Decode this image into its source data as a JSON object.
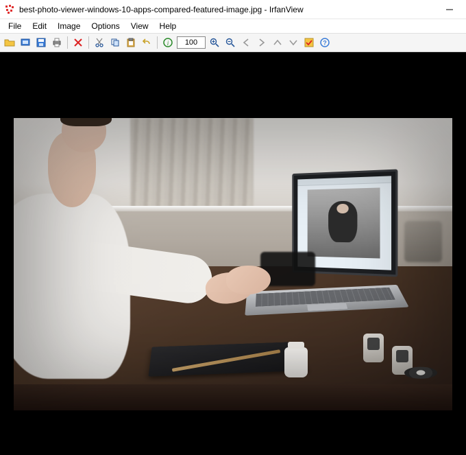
{
  "title": "best-photo-viewer-windows-10-apps-compared-featured-image.jpg - IrfanView",
  "menus": {
    "file": "File",
    "edit": "Edit",
    "image": "Image",
    "options": "Options",
    "view": "View",
    "help": "Help"
  },
  "toolbar": {
    "zoom_value": "100"
  },
  "icons": {
    "open": "open-folder-icon",
    "save": "floppy-icon",
    "slideshow": "slideshow-icon",
    "print": "printer-icon",
    "delete": "delete-x-icon",
    "cut": "scissors-icon",
    "copy": "copy-icon",
    "paste": "paste-icon",
    "undo": "undo-icon",
    "info": "info-icon",
    "zoom_in": "zoom-in-icon",
    "zoom_out": "zoom-out-icon",
    "prev": "arrow-left-icon",
    "next": "arrow-right-icon",
    "first": "arrow-up-first-icon",
    "last": "arrow-down-last-icon",
    "settings": "settings-check-icon",
    "about": "help-icon"
  }
}
